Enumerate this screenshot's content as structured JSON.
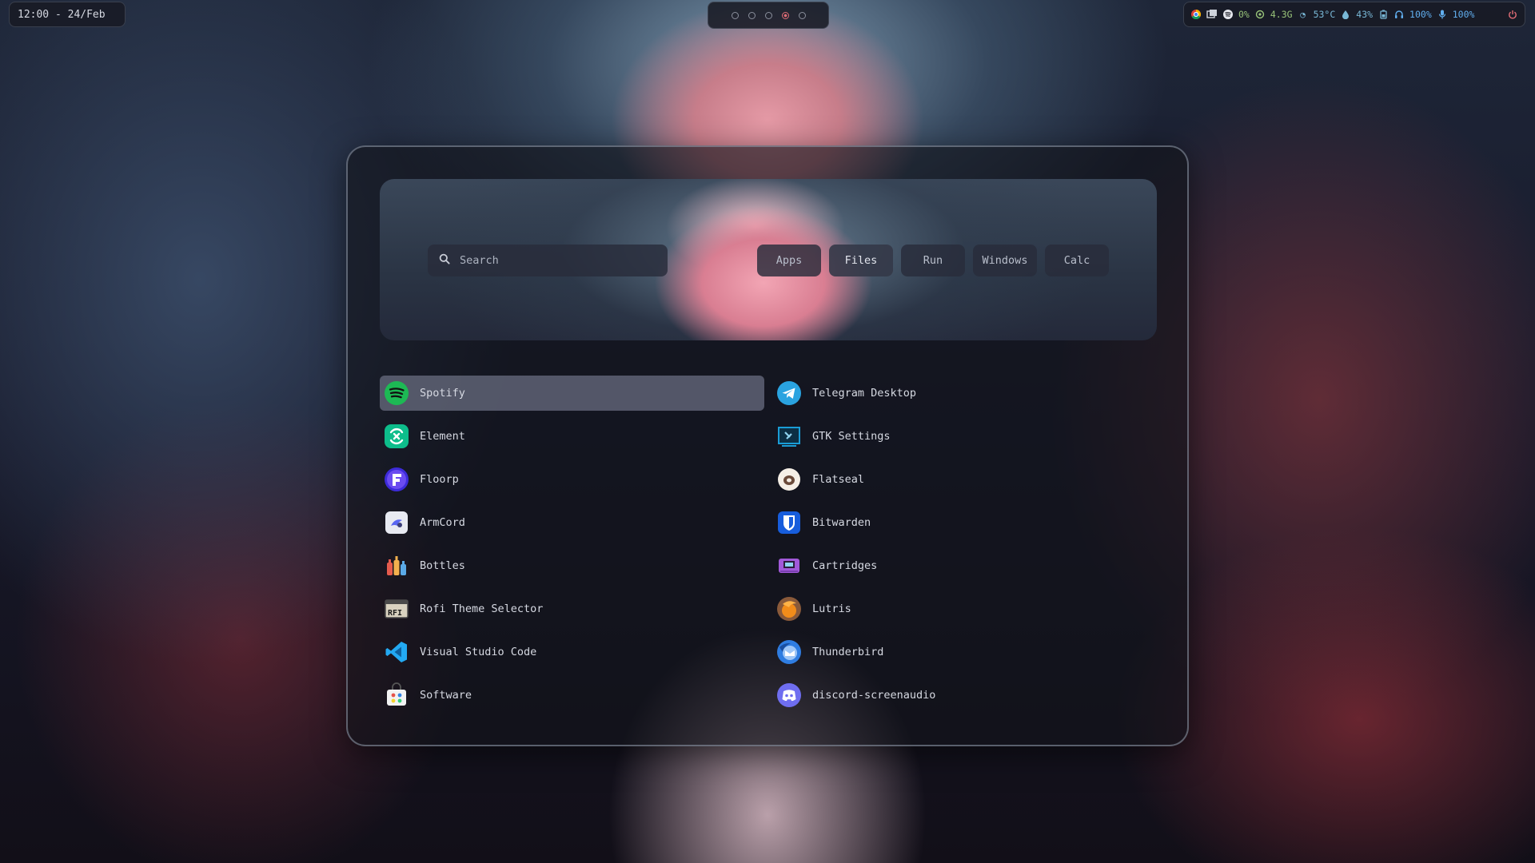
{
  "topbar": {
    "clock": "12:00 - 24/Feb",
    "workspaces": [
      {
        "active": false
      },
      {
        "active": false
      },
      {
        "active": false
      },
      {
        "active": true
      },
      {
        "active": false
      }
    ],
    "tray": {
      "cpu": "0%",
      "memory": "4.3G",
      "temperature": "53°C",
      "brightness": "43%",
      "volume": "100%",
      "mic": "100%"
    }
  },
  "launcher": {
    "search_placeholder": "Search",
    "modes": [
      "Apps",
      "Files",
      "Run",
      "Windows",
      "Calc"
    ],
    "active_mode": "Apps",
    "left_items": [
      {
        "label": "Spotify",
        "icon": "spotify-icon",
        "color": "#1db954",
        "selected": true
      },
      {
        "label": "Element",
        "icon": "element-icon",
        "color": "#0dbd8b"
      },
      {
        "label": "Floorp",
        "icon": "floorp-icon",
        "color": "#3d2bd9"
      },
      {
        "label": "ArmCord",
        "icon": "armcord-icon",
        "color": "#e8eaf2"
      },
      {
        "label": "Bottles",
        "icon": "bottles-icon",
        "color": "#e55b4d"
      },
      {
        "label": "Rofi Theme Selector",
        "icon": "rofi-icon",
        "color": "#d9d2c0"
      },
      {
        "label": "Visual Studio Code",
        "icon": "vscode-icon",
        "color": "#23a9f2"
      },
      {
        "label": "Software",
        "icon": "software-icon",
        "color": "#f2f2f2"
      }
    ],
    "right_items": [
      {
        "label": "Telegram Desktop",
        "icon": "telegram-icon",
        "color": "#2aa3e0"
      },
      {
        "label": "GTK Settings",
        "icon": "gtk-settings-icon",
        "color": "#1a9dd6"
      },
      {
        "label": "Flatseal",
        "icon": "flatseal-icon",
        "color": "#f5efe6"
      },
      {
        "label": "Bitwarden",
        "icon": "bitwarden-icon",
        "color": "#175ddc"
      },
      {
        "label": "Cartridges",
        "icon": "cartridges-icon",
        "color": "#a259d9"
      },
      {
        "label": "Lutris",
        "icon": "lutris-icon",
        "color": "#f28c1a"
      },
      {
        "label": "Thunderbird",
        "icon": "thunderbird-icon",
        "color": "#2f7de1"
      },
      {
        "label": "discord-screenaudio",
        "icon": "discord-icon",
        "color": "#6f6ef0"
      }
    ]
  }
}
